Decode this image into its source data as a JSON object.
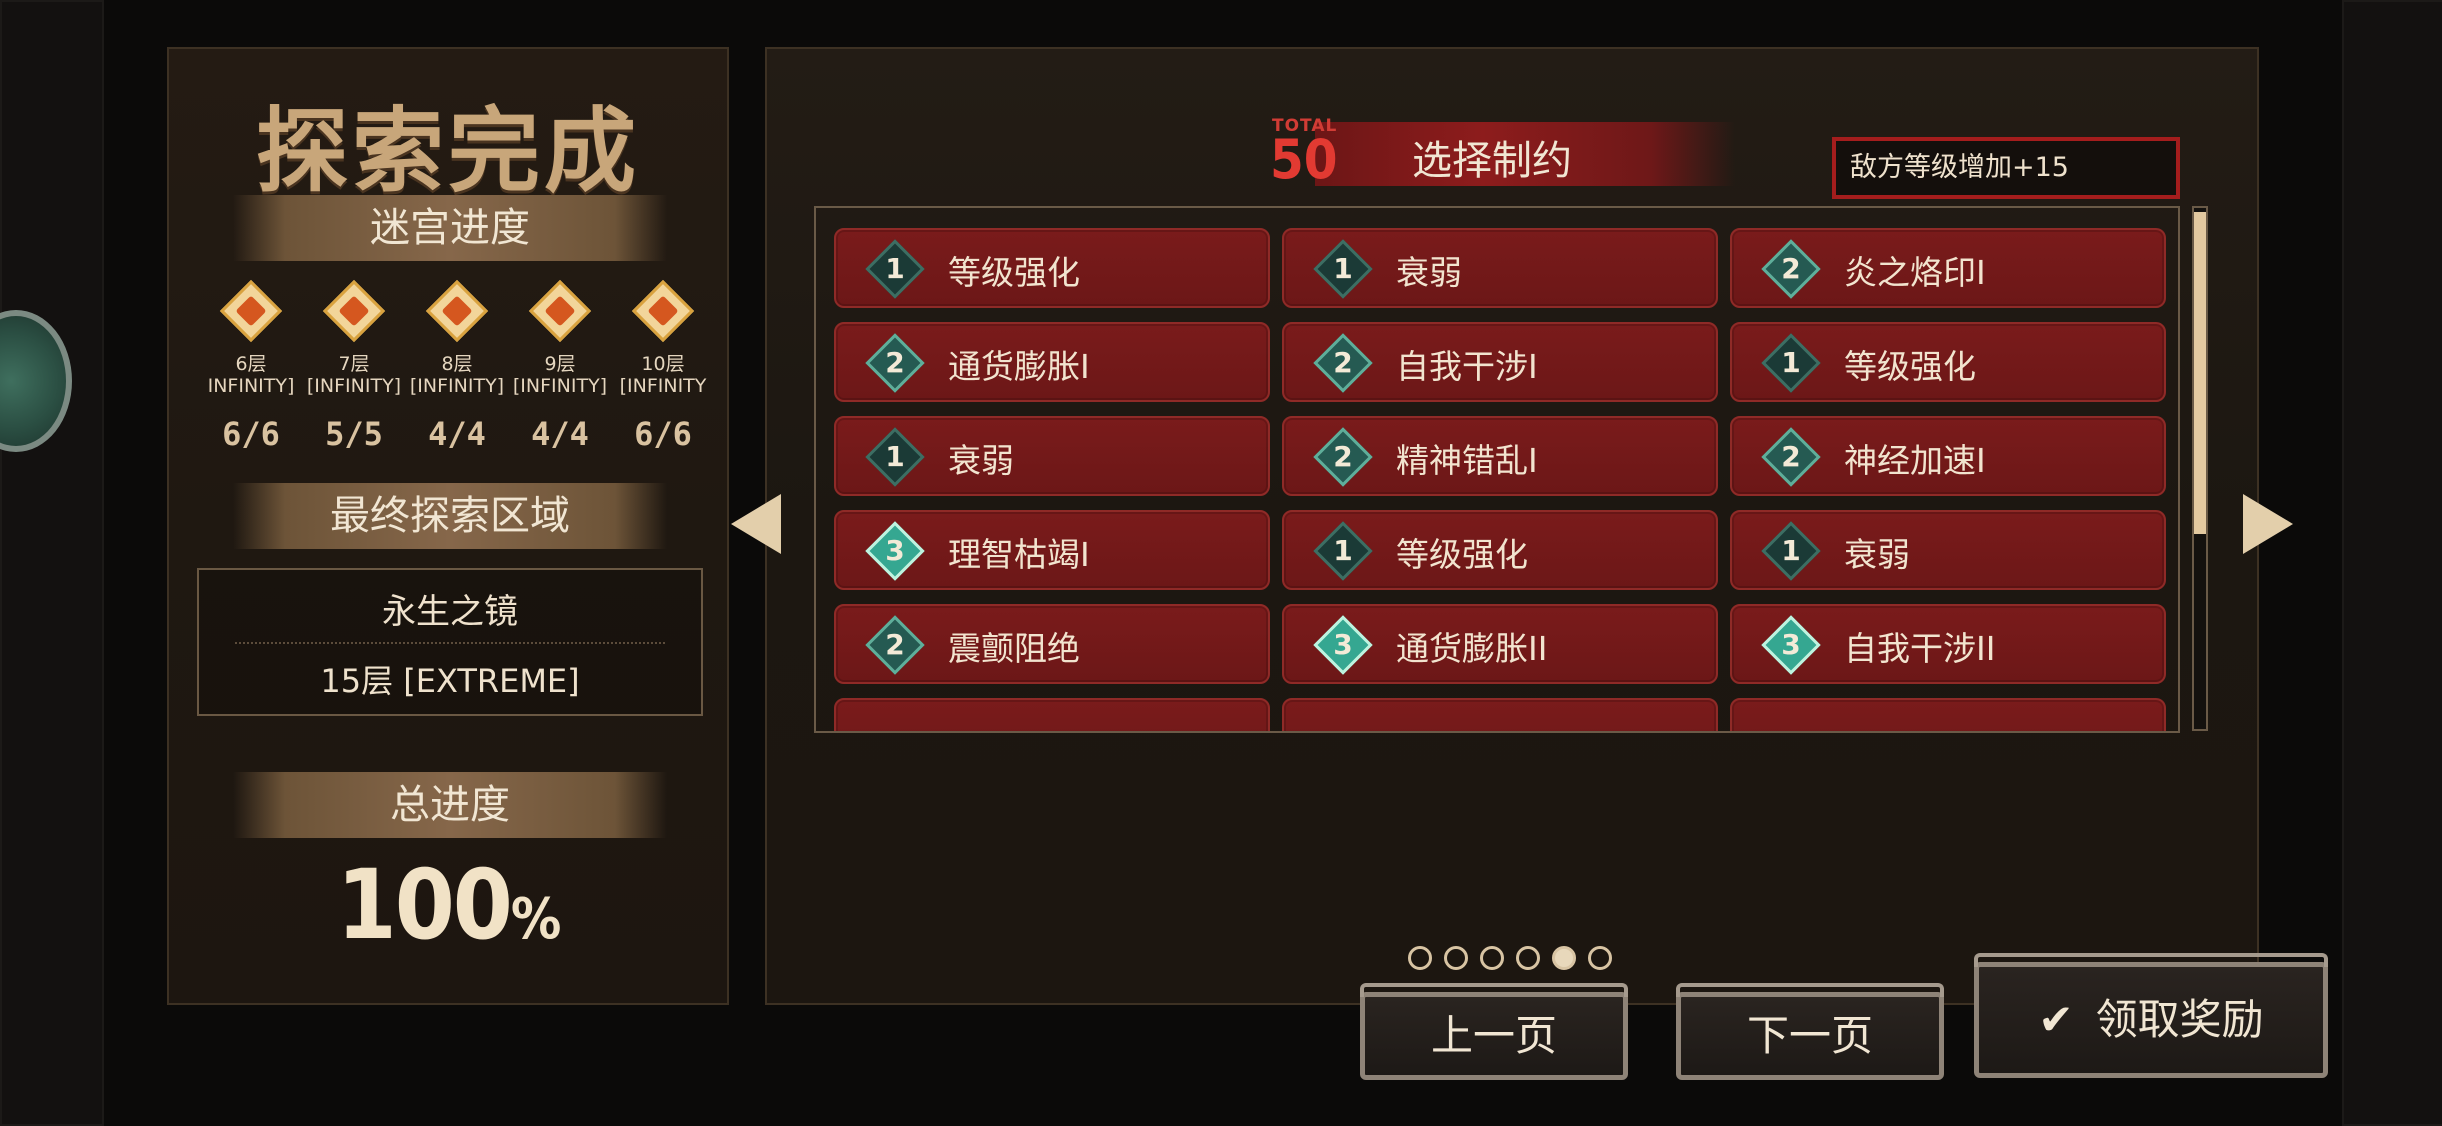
{
  "left_panel": {
    "title": "探索完成",
    "labyrinth_progress_label": "迷宫进度",
    "floors": [
      {
        "name": "6层",
        "mode": "INFINITY]",
        "count": "6/6"
      },
      {
        "name": "7层",
        "mode": "[INFINITY]",
        "count": "5/5"
      },
      {
        "name": "8层",
        "mode": "[INFINITY]",
        "count": "4/4"
      },
      {
        "name": "9层",
        "mode": "[INFINITY]",
        "count": "4/4"
      },
      {
        "name": "10层",
        "mode": "[INFINITY",
        "count": "6/6"
      }
    ],
    "final_area_label": "最终探索区域",
    "final_area_name": "永生之镜",
    "final_area_level": "15层 [EXTREME]",
    "total_progress_label": "总进度",
    "total_progress_value": "100",
    "total_progress_unit": "%"
  },
  "restrictions": {
    "total_label": "TOTAL",
    "total_value": "50",
    "title": "选择制约",
    "enemy_level_text": "敌方等级增加+15",
    "rows": [
      [
        {
          "level": "1",
          "label": "等级强化"
        },
        {
          "level": "1",
          "label": "衰弱"
        },
        {
          "level": "2",
          "label": "炎之烙印I"
        }
      ],
      [
        {
          "level": "2",
          "label": "通货膨胀I"
        },
        {
          "level": "2",
          "label": "自我干涉I"
        },
        {
          "level": "1",
          "label": "等级强化"
        }
      ],
      [
        {
          "level": "1",
          "label": "衰弱"
        },
        {
          "level": "2",
          "label": "精神错乱I"
        },
        {
          "level": "2",
          "label": "神经加速I"
        }
      ],
      [
        {
          "level": "3",
          "label": "理智枯竭I"
        },
        {
          "level": "1",
          "label": "等级强化"
        },
        {
          "level": "1",
          "label": "衰弱"
        }
      ],
      [
        {
          "level": "2",
          "label": "震颤阻绝"
        },
        {
          "level": "3",
          "label": "通货膨胀II"
        },
        {
          "level": "3",
          "label": "自我干涉II"
        }
      ]
    ]
  },
  "pagination": {
    "page_count": 6,
    "current_page": 5
  },
  "buttons": {
    "prev": "上一页",
    "next": "下一页",
    "claim": "领取奖励"
  },
  "colors": {
    "accent_red": "#a51d1d",
    "card_red": "#7a1b1b",
    "gold": "#c8a67a"
  }
}
